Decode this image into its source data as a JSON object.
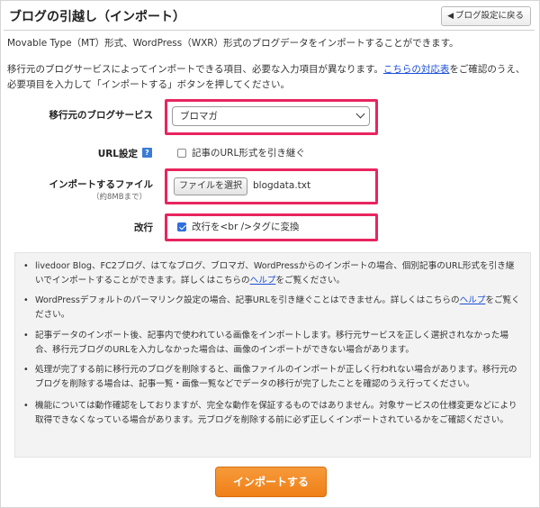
{
  "header": {
    "title": "ブログの引越し（インポート）",
    "back_label": "ブログ設定に戻る"
  },
  "intro": {
    "line1": "Movable Type（MT）形式、WordPress（WXR）形式のブログデータをインポートすることができます。",
    "line2_before": "移行元のブログサービスによってインポートできる項目、必要な入力項目が異なります。",
    "line2_link": "こちらの対応表",
    "line2_after": "をご確認のうえ、",
    "line3": "必要項目を入力して「インポートする」ボタンを押してください。"
  },
  "form": {
    "service": {
      "label": "移行元のブログサービス",
      "value": "ブロマガ"
    },
    "url": {
      "label": "URL設定",
      "help": "?",
      "checkbox_label": "記事のURL形式を引き継ぐ",
      "checked": false
    },
    "file": {
      "label": "インポートするファイル",
      "note": "（約8MBまで）",
      "button": "ファイルを選択",
      "filename": "blogdata.txt"
    },
    "linebreak": {
      "label": "改行",
      "checkbox_label": "改行を<br />タグに変換",
      "checked": true
    }
  },
  "notes": [
    {
      "text": "livedoor Blog、FC2ブログ、はてなブログ、ブロマガ、WordPressからのインポートの場合、個別記事のURL形式を引き継いでインポートすることができます。詳しくはこちらの",
      "link": "ヘルプ",
      "after": "をご覧ください。"
    },
    {
      "text": "WordPressデフォルトのパーマリンク設定の場合、記事URLを引き継ぐことはできません。詳しくはこちらの",
      "link": "ヘルプ",
      "after": "をご覧ください。"
    },
    {
      "text": "記事データのインポート後、記事内で使われている画像をインポートします。移行元サービスを正しく選択されなかった場合、移行元ブログのURLを入力しなかった場合は、画像のインポートができない場合があります。",
      "link": "",
      "after": ""
    },
    {
      "text": "処理が完了する前に移行元のブログを削除すると、画像ファイルのインポートが正しく行われない場合があります。移行元のブログを削除する場合は、記事一覧・画像一覧などでデータの移行が完了したことを確認のうえ行ってください。",
      "link": "",
      "after": ""
    },
    {
      "text": "機能については動作確認をしておりますが、完全な動作を保証するものではありません。対象サービスの仕様変更などにより取得できなくなっている場合があります。元ブログを削除する前に必ず正しくインポートされているかをご確認ください。",
      "link": "",
      "after": ""
    }
  ],
  "actions": {
    "import_label": "インポートする"
  },
  "colors": {
    "highlight": "#e8255f",
    "accent_button": "#ef7f17",
    "link": "#1a4fd6"
  }
}
